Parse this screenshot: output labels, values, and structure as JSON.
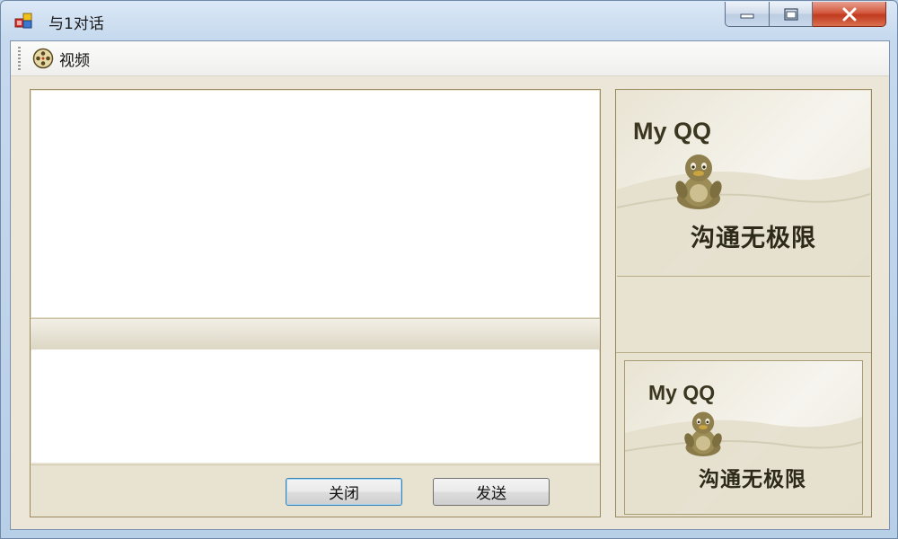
{
  "window": {
    "title": "与1对话",
    "controls": [
      "minimize",
      "maximize",
      "close"
    ]
  },
  "toolbar": {
    "video_label": "视频",
    "video_icon": "film-reel-icon"
  },
  "chat": {
    "messages": [],
    "input_value": ""
  },
  "buttons": {
    "close_label": "关闭",
    "send_label": "发送"
  },
  "banners": {
    "top": {
      "brand": "My QQ",
      "slogan": "沟通无极限",
      "icon": "qq-penguin-icon"
    },
    "bottom": {
      "brand": "My QQ",
      "slogan": "沟通无极限",
      "icon": "qq-penguin-icon"
    }
  },
  "colors": {
    "panel_bg": "#ebe6d8",
    "panel_border": "#9a8a5e",
    "titlebar": "#c6d9ee",
    "close_button": "#c23a1f"
  }
}
